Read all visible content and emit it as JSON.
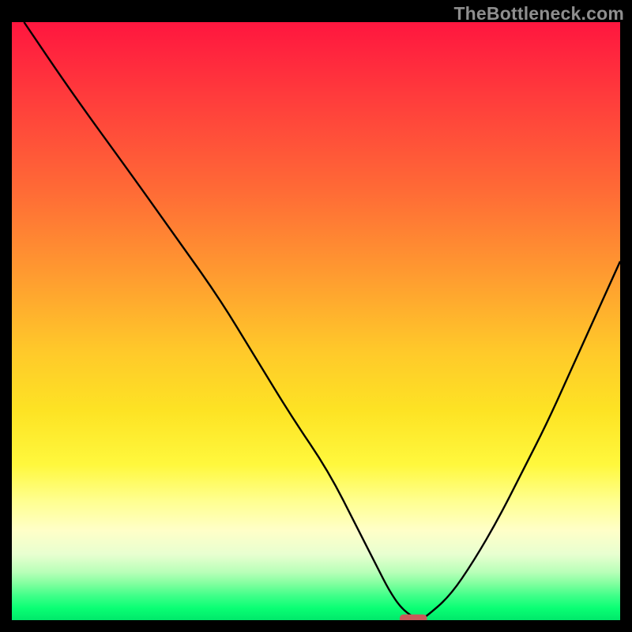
{
  "watermark": "TheBottleneck.com",
  "chart_data": {
    "type": "line",
    "title": "",
    "xlabel": "",
    "ylabel": "",
    "xlim": [
      0,
      100
    ],
    "ylim": [
      0,
      100
    ],
    "grid": false,
    "series": [
      {
        "name": "bottleneck-curve",
        "x": [
          2,
          10,
          20,
          27,
          34,
          40,
          46,
          52,
          57,
          60,
          62,
          64,
          66,
          67,
          68,
          72,
          76,
          80,
          84,
          88,
          92,
          96,
          100
        ],
        "y": [
          100,
          88,
          74,
          64,
          54,
          44,
          34,
          25,
          15,
          9,
          5,
          2,
          0.5,
          0,
          0.5,
          4,
          10,
          17,
          25,
          33,
          42,
          51,
          60
        ]
      }
    ],
    "marker": {
      "name": "optimal-point",
      "x": 66,
      "y": 0,
      "width_pct": 4.5,
      "height_pct": 1.4,
      "color": "#c95a5a"
    },
    "gradient_colors": {
      "top": "#ff163f",
      "mid": "#fde324",
      "bottom": "#00e86a"
    }
  }
}
